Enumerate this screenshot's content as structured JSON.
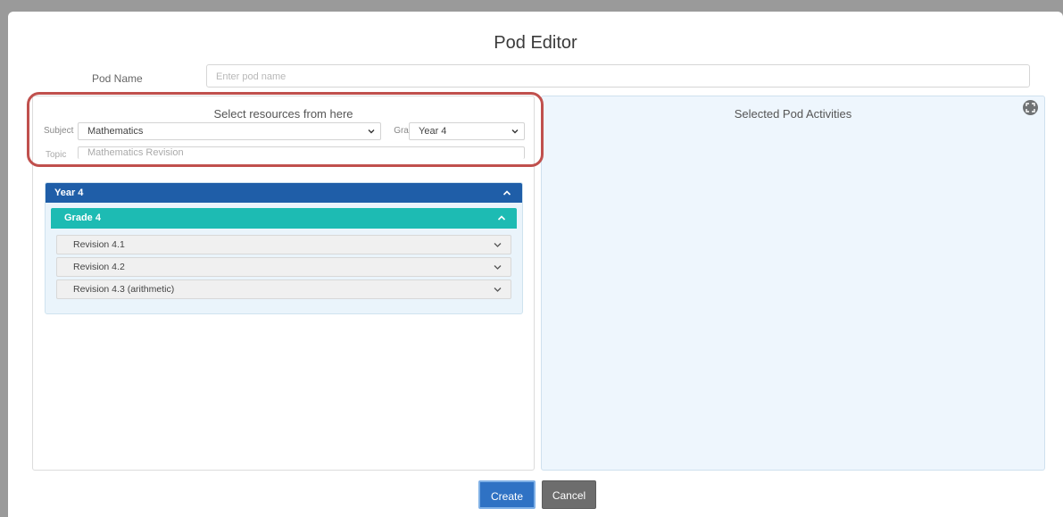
{
  "dialog": {
    "title": "Pod Editor"
  },
  "pod_name": {
    "label": "Pod Name",
    "placeholder": "Enter pod name"
  },
  "resources": {
    "heading": "Select resources from here",
    "subject_label": "Subject",
    "subject_value": "Mathematics",
    "grade_label": "Grade",
    "grade_value": "Year 4",
    "topic_label": "Topic",
    "topic_value": "Mathematics Revision"
  },
  "accordion": {
    "year_label": "Year 4",
    "grade_label": "Grade 4",
    "items": [
      {
        "label": "Revision 4.1"
      },
      {
        "label": "Revision 4.2"
      },
      {
        "label": "Revision 4.3 (arithmetic)"
      }
    ]
  },
  "selected": {
    "heading": "Selected Pod Activities"
  },
  "actions": {
    "create_label": "Create",
    "cancel_label": "Cancel"
  },
  "colors": {
    "year_header": "#1f5ea8",
    "grade_header": "#1dbbb3",
    "create_button": "#2f72c4",
    "cancel_button": "#6d6d6d",
    "annotation": "#c0504d"
  },
  "icons": {
    "select_arrow": "chevron-down-icon",
    "collapse": "chevron-up-icon",
    "expand": "expand-icon"
  }
}
